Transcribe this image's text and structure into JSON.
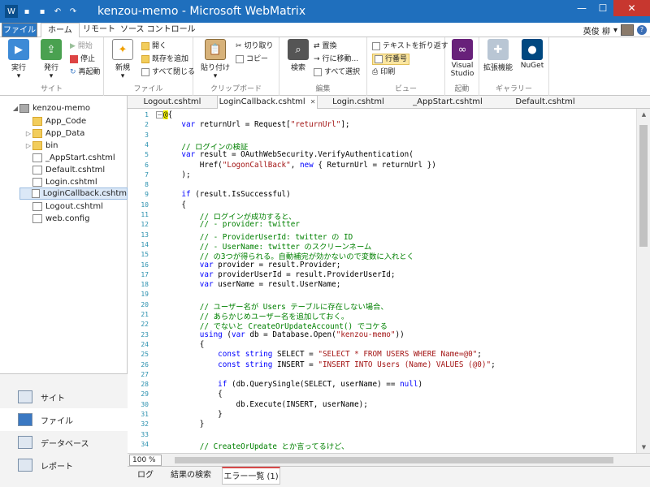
{
  "window": {
    "title": "kenzou-memo - Microsoft WebMatrix"
  },
  "ribbon_tabs": {
    "file": "ファイル",
    "home": "ホーム",
    "remote": "リモート",
    "source": "ソース コントロール"
  },
  "user": {
    "name": "英俊 柳"
  },
  "ribbon": {
    "site": {
      "label": "サイト",
      "run": "実行",
      "publish": "発行",
      "start": "開始",
      "stop": "停止",
      "restart": "再起動"
    },
    "file": {
      "label": "ファイル",
      "new": "新規",
      "open": "開く",
      "add_existing": "既存を追加",
      "close_all": "すべて閉じる"
    },
    "clipboard": {
      "label": "クリップボード",
      "paste": "貼り付け",
      "cut": "切り取り",
      "copy": "コピー"
    },
    "edit": {
      "label": "編集",
      "search": "検索",
      "replace": "置換",
      "goto_line": "行に移動...",
      "select_all": "すべて選択"
    },
    "view": {
      "label": "ビュー",
      "wrap_text": "テキストを折り返す",
      "line_numbers": "行番号",
      "print": "印刷"
    },
    "launch": {
      "label": "起動",
      "visual_studio": "Visual Studio"
    },
    "gallery": {
      "label": "ギャラリー",
      "extensions": "拡張機能",
      "nuget": "NuGet"
    }
  },
  "tree": {
    "root": "kenzou-memo",
    "items": [
      {
        "name": "App_Code",
        "type": "folder"
      },
      {
        "name": "App_Data",
        "type": "folder"
      },
      {
        "name": "bin",
        "type": "folder"
      },
      {
        "name": "_AppStart.cshtml",
        "type": "file"
      },
      {
        "name": "Default.cshtml",
        "type": "file"
      },
      {
        "name": "Login.cshtml",
        "type": "file"
      },
      {
        "name": "LoginCallback.cshtm",
        "type": "file"
      },
      {
        "name": "Logout.cshtml",
        "type": "file"
      },
      {
        "name": "web.config",
        "type": "file"
      }
    ]
  },
  "sidenav": {
    "site": "サイト",
    "files": "ファイル",
    "database": "データベース",
    "reports": "レポート"
  },
  "doc_tabs": [
    "Logout.cshtml",
    "LoginCallback.cshtml",
    "Login.cshtml",
    "_AppStart.cshtml",
    "Default.cshtml"
  ],
  "code_lines": [
    "@{",
    "    var returnUrl = Request[\"returnUrl\"];",
    "",
    "    // ログインの検証",
    "    var result = OAuthWebSecurity.VerifyAuthentication(",
    "        Href(\"LogonCallBack\", new { ReturnUrl = returnUrl })",
    "    );",
    "",
    "    if (result.IsSuccessful)",
    "    {",
    "        // ログインが成功すると、",
    "        // - provider: twitter",
    "        // - ProviderUserId: twitter の ID",
    "        // - UserName: twitter のスクリーンネーム",
    "        // の3つが得られる。自動補完が効かないので変数に入れとく",
    "        var provider = result.Provider;",
    "        var providerUserId = result.ProviderUserId;",
    "        var userName = result.UserName;",
    "",
    "        // ユーザー名が Users テーブルに存在しない場合、",
    "        // あらかじめユーザー名を追加しておく。",
    "        // でないと CreateOrUpdateAccount() でコケる",
    "        using (var db = Database.Open(\"kenzou-memo\"))",
    "        {",
    "            const string SELECT = \"SELECT * FROM USERS WHERE Name=@0\";",
    "            const string INSERT = \"INSERT INTO Users (Name) VALUES (@0)\";",
    "",
    "            if (db.QuerySingle(SELECT, userName) == null)",
    "            {",
    "                db.Execute(INSERT, userName);",
    "            }",
    "        }",
    "",
    "        // CreateOrUpdate とか言ってるけど、"
  ],
  "zoom": "100 %",
  "panel_tabs": [
    "ログ",
    "結果の検索",
    "エラー一覧 (1)"
  ]
}
